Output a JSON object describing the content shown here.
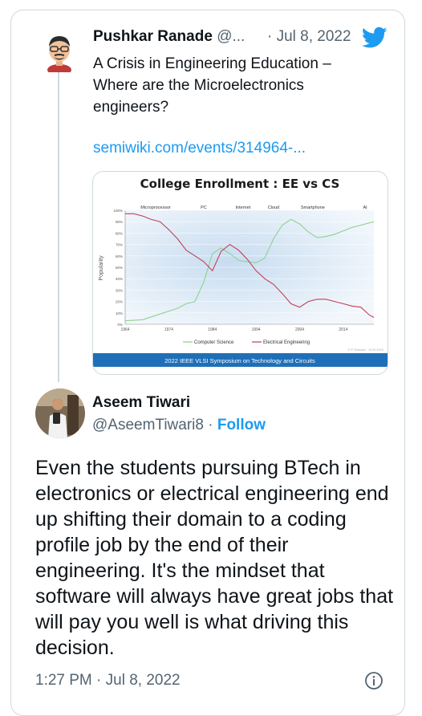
{
  "quoted_tweet": {
    "author_name": "Pushkar Ranade",
    "author_handle": "@...",
    "date": "· Jul 8, 2022",
    "text": "A Crisis in Engineering Education – Where are the Microelectronics engineers?",
    "link": "semiwiki.com/events/314964-..."
  },
  "main_tweet": {
    "author_name": "Aseem Tiwari",
    "author_handle": "@AseemTiwari8",
    "separator": " · ",
    "follow_label": "Follow",
    "text": "Even the students pursuing BTech in electronics or electrical engineering end up shifting their domain to a coding profile job by the end of their engineering. It's the mindset that software will always have great jobs that will pay you well is what driving this decision.",
    "timestamp": "1:27 PM · Jul 8, 2022"
  },
  "icons": {
    "platform": "twitter-bird-icon",
    "info": "info-icon"
  },
  "colors": {
    "accent": "#1d9bf0",
    "secondary_text": "#536471",
    "cs_line": "#8fd18f",
    "ee_line": "#c24055",
    "banner": "#1e6fb8"
  },
  "chart_data": {
    "type": "line",
    "title": "College Enrollment : EE vs CS",
    "ylabel": "Popularity",
    "ylim": [
      0,
      100
    ],
    "y_ticks": [
      "0%",
      "10%",
      "20%",
      "30%",
      "40%",
      "50%",
      "60%",
      "70%",
      "80%",
      "90%",
      "100%"
    ],
    "x_ticks": [
      "1964",
      "1974",
      "1984",
      "1994",
      "2004",
      "2014"
    ],
    "xlim": [
      1964,
      2021
    ],
    "eras": [
      {
        "label": "Microprocessor",
        "year": 1971
      },
      {
        "label": "PC",
        "year": 1982
      },
      {
        "label": "Internet",
        "year": 1991
      },
      {
        "label": "Cloud",
        "year": 1998
      },
      {
        "label": "Smartphone",
        "year": 2007
      },
      {
        "label": "AI",
        "year": 2019
      }
    ],
    "series": [
      {
        "name": "Computer Science",
        "x": [
          1964,
          1968,
          1972,
          1976,
          1978,
          1980,
          1982,
          1984,
          1986,
          1988,
          1990,
          1992,
          1994,
          1996,
          1998,
          2000,
          2002,
          2004,
          2006,
          2008,
          2010,
          2012,
          2014,
          2016,
          2018,
          2021
        ],
        "y": [
          3,
          4,
          9,
          14,
          18,
          20,
          37,
          62,
          67,
          62,
          56,
          55,
          54,
          58,
          75,
          87,
          92,
          88,
          81,
          76,
          77,
          79,
          82,
          85,
          87,
          90
        ]
      },
      {
        "name": "Electrical Engineering",
        "x": [
          1964,
          1966,
          1968,
          1970,
          1972,
          1974,
          1976,
          1978,
          1980,
          1982,
          1984,
          1986,
          1988,
          1990,
          1992,
          1994,
          1996,
          1998,
          2000,
          2002,
          2004,
          2006,
          2008,
          2010,
          2012,
          2014,
          2016,
          2018,
          2020,
          2021
        ],
        "y": [
          97,
          97,
          95,
          92,
          90,
          83,
          75,
          65,
          60,
          55,
          47,
          64,
          70,
          65,
          57,
          47,
          40,
          35,
          27,
          18,
          15,
          20,
          22,
          22,
          20,
          18,
          16,
          15,
          8,
          6
        ]
      }
    ],
    "banner": "2022 IEEE VLSI Symposium on Technology and Circuits",
    "watermark": "© P. Ranade · VLSI 2022"
  }
}
